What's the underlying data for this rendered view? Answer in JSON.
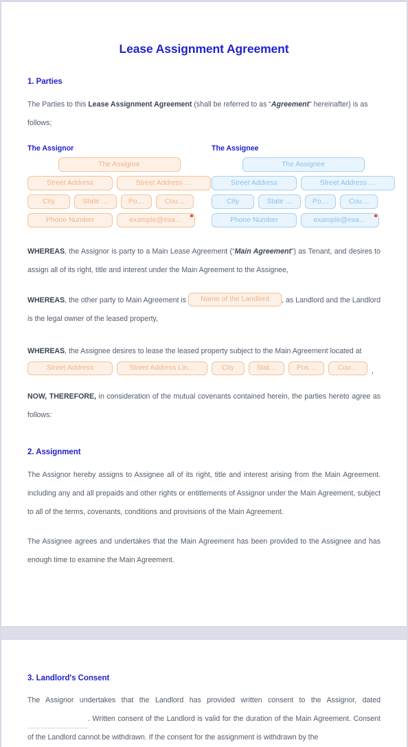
{
  "document": {
    "title": "Lease Assignment Agreement"
  },
  "sections": {
    "parties": {
      "heading": "1. Parties",
      "intro_pre": "The Parties to this ",
      "intro_bold": "Lease Assignment Agreement",
      "intro_mid": " (shall be referred to as “",
      "intro_em": "Agreement",
      "intro_post": "” hereinafter) is as follows;",
      "assignor": {
        "label": "The Assignor",
        "name": "The Assignor",
        "street_address": "Street Address",
        "street_address_2": "Street Address …",
        "city": "City",
        "state": "State …",
        "postal": "Po…",
        "country": "Cou…",
        "phone": "Phone Number",
        "email": "example@exa…"
      },
      "assignee": {
        "label": "The Assignee",
        "name": "The Assignee",
        "street_address": "Street Address",
        "street_address_2": "Street Address …",
        "city": "City",
        "state": "State …",
        "postal": "Po…",
        "country": "Cou…",
        "phone": "Phone Number",
        "email": "example@exa…"
      },
      "whereas_1": {
        "lead": "WHEREAS",
        "text_a": ", the Assignor is party to a Main Lease Agreement (“",
        "em": "Main Agreement",
        "text_b": "”) as Tenant, and desires to assign all of its right, title and interest under the Main Agreement to the Assignee,"
      },
      "whereas_2": {
        "lead": "WHEREAS",
        "text_a": ", the other party to Main Agreement is ",
        "landlord_field": "Name of the Landlord",
        "text_b": ", as Landlord and the Landlord is the legal owner of the leased property,"
      },
      "whereas_3": {
        "lead": "WHEREAS",
        "text_a": ", the Assignee desires to lease the leased property subject to the Main Agreement located at",
        "street_address": "Street Address",
        "street_address_2": "Street Address Lin…",
        "city": "City",
        "state": "Stat…",
        "postal": "Pos…",
        "country": "Cou…",
        "trailing_comma": ","
      },
      "now_therefore": {
        "lead": "NOW, THEREFORE,",
        "text": " in consideration of the mutual covenants contained herein, the parties hereto agree as follows:"
      }
    },
    "assignment": {
      "heading": "2. Assignment",
      "paragraph_1": "The Assignor hereby assigns to Assignee all of its right, title and interest arising from the Main Agreement. including any and all prepaids and other rights or entitlements of Assignor under the Main Agreement, subject to all of the terms, covenants, conditions and provisions of the Main Agreement.",
      "paragraph_2": "The Assignee agrees and undertakes that the Main Agreement has been provided to the Assignee and has enough time to examine the Main Agreement."
    },
    "landlords_consent": {
      "heading": "3. Landlord's Consent",
      "text_a": "The Assignor undertakes that the Landlord has provided written consent to the Assignor, dated ",
      "text_b": ". Written consent of the Landlord is valid for the duration of the Main Agreement. Consent of the Landlord cannot be withdrawn. If the consent for the assignment is withdrawn by the"
    }
  },
  "theme": {
    "heading_color": "#2222cc",
    "body_color": "#515c6b",
    "assignor_field_bg": "#fdf1e7",
    "assignor_field_border": "#f6c193",
    "assignee_field_bg": "#e9f4fd",
    "assignee_field_border": "#a6d2f2",
    "required_marker_color": "#e8532f",
    "page_break_color": "#dedeeb"
  }
}
